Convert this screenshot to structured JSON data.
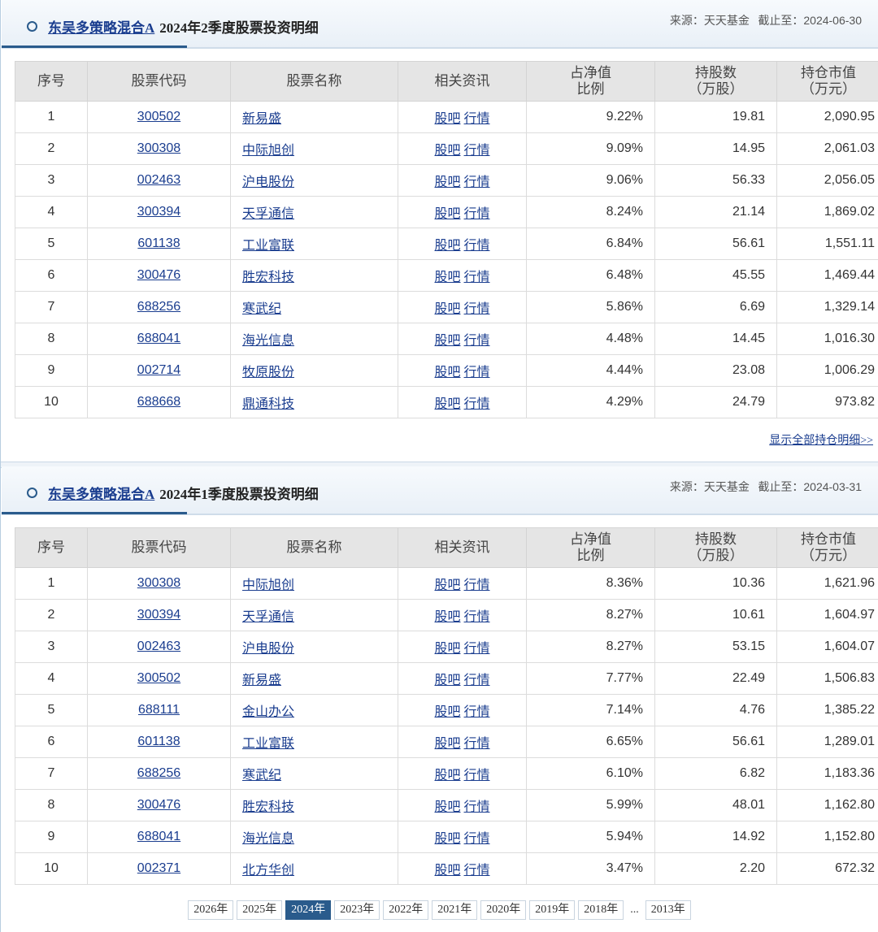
{
  "sections": [
    {
      "fund_name": "东吴多策略混合A",
      "period_title": "2024年2季度股票投资明细",
      "source_label": "来源：天天基金",
      "deadline_label": "截止至：",
      "deadline_date": "2024-06-30",
      "headers": [
        "序号",
        "股票代码",
        "股票名称",
        "相关资讯",
        "占净值比例",
        "持股数（万股）",
        "持仓市值（万元）"
      ],
      "headers_split": [
        [
          "序号"
        ],
        [
          "股票代码"
        ],
        [
          "股票名称"
        ],
        [
          "相关资讯"
        ],
        [
          "占净值",
          "比例"
        ],
        [
          "持股数",
          "（万股）"
        ],
        [
          "持仓市值",
          "（万元）"
        ]
      ],
      "news_links": [
        "股吧",
        "行情"
      ],
      "rows": [
        {
          "no": "1",
          "code": "300502",
          "name": "新易盛",
          "ratio": "9.22%",
          "shares": "19.81",
          "value": "2,090.95"
        },
        {
          "no": "2",
          "code": "300308",
          "name": "中际旭创",
          "ratio": "9.09%",
          "shares": "14.95",
          "value": "2,061.03"
        },
        {
          "no": "3",
          "code": "002463",
          "name": "沪电股份",
          "ratio": "9.06%",
          "shares": "56.33",
          "value": "2,056.05"
        },
        {
          "no": "4",
          "code": "300394",
          "name": "天孚通信",
          "ratio": "8.24%",
          "shares": "21.14",
          "value": "1,869.02"
        },
        {
          "no": "5",
          "code": "601138",
          "name": "工业富联",
          "ratio": "6.84%",
          "shares": "56.61",
          "value": "1,551.11"
        },
        {
          "no": "6",
          "code": "300476",
          "name": "胜宏科技",
          "ratio": "6.48%",
          "shares": "45.55",
          "value": "1,469.44"
        },
        {
          "no": "7",
          "code": "688256",
          "name": "寒武纪",
          "ratio": "5.86%",
          "shares": "6.69",
          "value": "1,329.14"
        },
        {
          "no": "8",
          "code": "688041",
          "name": "海光信息",
          "ratio": "4.48%",
          "shares": "14.45",
          "value": "1,016.30"
        },
        {
          "no": "9",
          "code": "002714",
          "name": "牧原股份",
          "ratio": "4.44%",
          "shares": "23.08",
          "value": "1,006.29"
        },
        {
          "no": "10",
          "code": "688668",
          "name": "鼎通科技",
          "ratio": "4.29%",
          "shares": "24.79",
          "value": "973.82"
        }
      ],
      "show_all": "显示全部持仓明细>>"
    },
    {
      "fund_name": "东吴多策略混合A",
      "period_title": "2024年1季度股票投资明细",
      "source_label": "来源：天天基金",
      "deadline_label": "截止至：",
      "deadline_date": "2024-03-31",
      "headers_split": [
        [
          "序号"
        ],
        [
          "股票代码"
        ],
        [
          "股票名称"
        ],
        [
          "相关资讯"
        ],
        [
          "占净值",
          "比例"
        ],
        [
          "持股数",
          "（万股）"
        ],
        [
          "持仓市值",
          "（万元）"
        ]
      ],
      "news_links": [
        "股吧",
        "行情"
      ],
      "rows": [
        {
          "no": "1",
          "code": "300308",
          "name": "中际旭创",
          "ratio": "8.36%",
          "shares": "10.36",
          "value": "1,621.96"
        },
        {
          "no": "2",
          "code": "300394",
          "name": "天孚通信",
          "ratio": "8.27%",
          "shares": "10.61",
          "value": "1,604.97"
        },
        {
          "no": "3",
          "code": "002463",
          "name": "沪电股份",
          "ratio": "8.27%",
          "shares": "53.15",
          "value": "1,604.07"
        },
        {
          "no": "4",
          "code": "300502",
          "name": "新易盛",
          "ratio": "7.77%",
          "shares": "22.49",
          "value": "1,506.83"
        },
        {
          "no": "5",
          "code": "688111",
          "name": "金山办公",
          "ratio": "7.14%",
          "shares": "4.76",
          "value": "1,385.22"
        },
        {
          "no": "6",
          "code": "601138",
          "name": "工业富联",
          "ratio": "6.65%",
          "shares": "56.61",
          "value": "1,289.01"
        },
        {
          "no": "7",
          "code": "688256",
          "name": "寒武纪",
          "ratio": "6.10%",
          "shares": "6.82",
          "value": "1,183.36"
        },
        {
          "no": "8",
          "code": "300476",
          "name": "胜宏科技",
          "ratio": "5.99%",
          "shares": "48.01",
          "value": "1,162.80"
        },
        {
          "no": "9",
          "code": "688041",
          "name": "海光信息",
          "ratio": "5.94%",
          "shares": "14.92",
          "value": "1,152.80"
        },
        {
          "no": "10",
          "code": "002371",
          "name": "北方华创",
          "ratio": "3.47%",
          "shares": "2.20",
          "value": "672.32"
        }
      ]
    }
  ],
  "years": {
    "items": [
      "2026年",
      "2025年",
      "2024年",
      "2023年",
      "2022年",
      "2021年",
      "2020年",
      "2019年",
      "2018年",
      "...",
      "2013年"
    ],
    "active": "2024年"
  },
  "colors": {
    "accent": "#2a5b8c",
    "link": "#1a3d8f",
    "header_bg": "#e5e5e5"
  }
}
